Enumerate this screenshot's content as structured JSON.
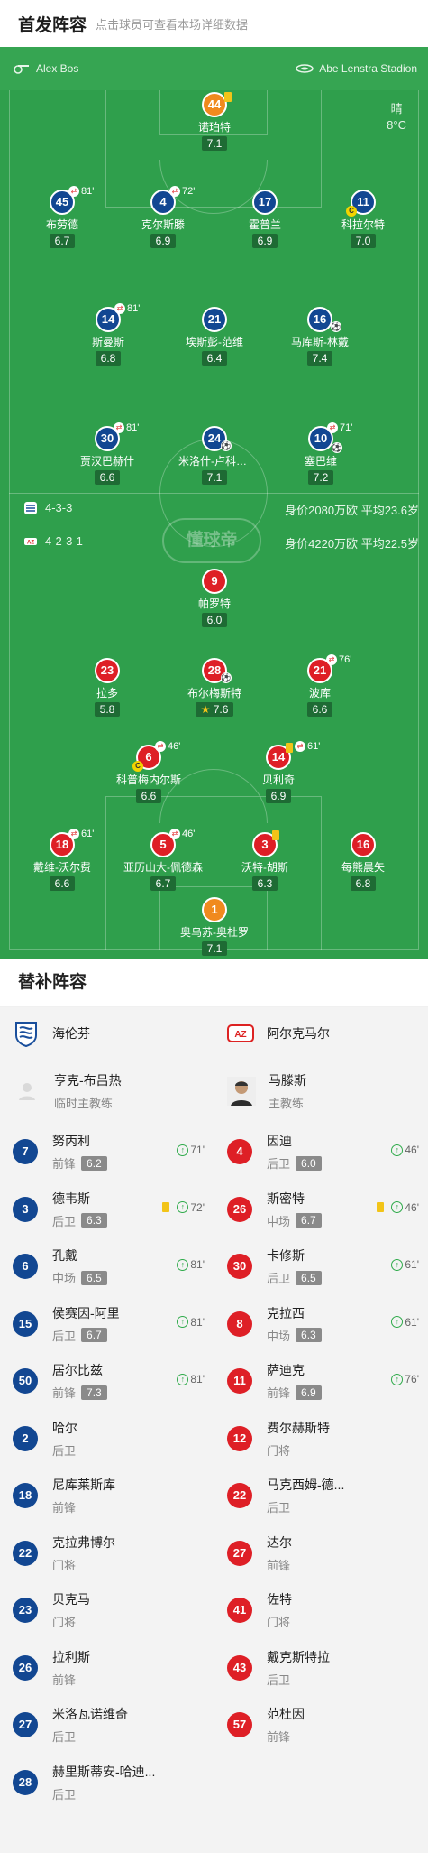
{
  "header": {
    "title": "首发阵容",
    "subtitle": "点击球员可查看本场详细数据"
  },
  "stadium": {
    "home_label": "Alex Bos",
    "away_label": "Abe Lenstra Stadion"
  },
  "weather": {
    "condition": "晴",
    "temp": "8°C"
  },
  "home_lineup": [
    {
      "num": "44",
      "name": "诺珀特",
      "rating": "7.1",
      "gk": true,
      "yellow": true
    },
    {
      "num": "45",
      "name": "布劳德",
      "rating": "6.7",
      "sub": "81'"
    },
    {
      "num": "4",
      "name": "克尔斯滕",
      "rating": "6.9",
      "sub": "72'"
    },
    {
      "num": "17",
      "name": "霍普兰",
      "rating": "6.9"
    },
    {
      "num": "11",
      "name": "科拉尔特",
      "rating": "7.0",
      "captain": true
    },
    {
      "num": "14",
      "name": "斯曼斯",
      "rating": "6.8",
      "sub": "81'"
    },
    {
      "num": "21",
      "name": "埃斯彭-范维",
      "rating": "6.4"
    },
    {
      "num": "16",
      "name": "马库斯-林戴",
      "rating": "7.4",
      "goal": true
    },
    {
      "num": "30",
      "name": "贾汉巴赫什",
      "rating": "6.6",
      "sub": "81'"
    },
    {
      "num": "24",
      "name": "米洛什-卢科维奇",
      "rating": "7.1",
      "goal": true
    },
    {
      "num": "10",
      "name": "塞巴维",
      "rating": "7.2",
      "sub": "71'",
      "goal": true
    }
  ],
  "formation_home": {
    "shape": "4-3-3",
    "value": "身价2080万欧",
    "age": "平均23.6岁"
  },
  "formation_away": {
    "shape": "4-2-3-1",
    "value": "身价4220万欧",
    "age": "平均22.5岁"
  },
  "watermark": "懂球帝",
  "away_lineup": [
    {
      "num": "9",
      "name": "帕罗特",
      "rating": "6.0"
    },
    {
      "num": "23",
      "name": "拉多",
      "rating": "5.8"
    },
    {
      "num": "28",
      "name": "布尔梅斯特",
      "rating": "7.6",
      "goal": true,
      "best": true
    },
    {
      "num": "21",
      "name": "波库",
      "rating": "6.6",
      "sub": "76'"
    },
    {
      "num": "6",
      "name": "科普梅内尔斯",
      "rating": "6.6",
      "sub": "46'",
      "captain": true
    },
    {
      "num": "14",
      "name": "贝利奇",
      "rating": "6.9",
      "sub": "61'",
      "yellow": true
    },
    {
      "num": "18",
      "name": "戴维-沃尔费",
      "rating": "6.6",
      "sub": "61'"
    },
    {
      "num": "5",
      "name": "亚历山大-佩德森",
      "rating": "6.7",
      "sub": "46'"
    },
    {
      "num": "3",
      "name": "沃特-胡斯",
      "rating": "6.3",
      "yellow": true
    },
    {
      "num": "16",
      "name": "每熊晨矢",
      "rating": "6.8"
    },
    {
      "num": "1",
      "name": "奥乌苏-奥杜罗",
      "rating": "7.1",
      "gk": true
    }
  ],
  "subs": {
    "title": "替补阵容",
    "home": {
      "team": "海伦芬",
      "coach": {
        "name": "亨克-布吕热",
        "role": "临时主教练"
      },
      "players": [
        {
          "num": "7",
          "name": "努丙利",
          "pos": "前锋",
          "rating": "6.2",
          "in": "71'"
        },
        {
          "num": "3",
          "name": "德韦斯",
          "pos": "后卫",
          "rating": "6.3",
          "in": "72'",
          "yellow": true
        },
        {
          "num": "6",
          "name": "孔戴",
          "pos": "中场",
          "rating": "6.5",
          "in": "81'"
        },
        {
          "num": "15",
          "name": "侯赛因-阿里",
          "pos": "后卫",
          "rating": "6.7",
          "in": "81'"
        },
        {
          "num": "50",
          "name": "居尔比兹",
          "pos": "前锋",
          "rating": "7.3",
          "in": "81'"
        },
        {
          "num": "2",
          "name": "哈尔",
          "pos": "后卫"
        },
        {
          "num": "18",
          "name": "尼库莱斯库",
          "pos": "前锋"
        },
        {
          "num": "22",
          "name": "克拉弗博尔",
          "pos": "门将"
        },
        {
          "num": "23",
          "name": "贝克马",
          "pos": "门将"
        },
        {
          "num": "26",
          "name": "拉利斯",
          "pos": "前锋"
        },
        {
          "num": "27",
          "name": "米洛瓦诺维奇",
          "pos": "后卫"
        },
        {
          "num": "28",
          "name": "赫里斯蒂安-哈迪...",
          "pos": "后卫"
        }
      ]
    },
    "away": {
      "team": "阿尔克马尔",
      "coach": {
        "name": "马滕斯",
        "role": "主教练"
      },
      "players": [
        {
          "num": "4",
          "name": "因迪",
          "pos": "后卫",
          "rating": "6.0",
          "in": "46'"
        },
        {
          "num": "26",
          "name": "斯密特",
          "pos": "中场",
          "rating": "6.7",
          "in": "46'",
          "yellow": true
        },
        {
          "num": "30",
          "name": "卡修斯",
          "pos": "后卫",
          "rating": "6.5",
          "in": "61'"
        },
        {
          "num": "8",
          "name": "克拉西",
          "pos": "中场",
          "rating": "6.3",
          "in": "61'"
        },
        {
          "num": "11",
          "name": "萨迪克",
          "pos": "前锋",
          "rating": "6.9",
          "in": "76'"
        },
        {
          "num": "12",
          "name": "费尔赫斯特",
          "pos": "门将"
        },
        {
          "num": "22",
          "name": "马克西姆-德...",
          "pos": "后卫"
        },
        {
          "num": "27",
          "name": "达尔",
          "pos": "前锋"
        },
        {
          "num": "41",
          "name": "佐特",
          "pos": "门将"
        },
        {
          "num": "43",
          "name": "戴克斯特拉",
          "pos": "后卫"
        },
        {
          "num": "57",
          "name": "范杜因",
          "pos": "前锋"
        }
      ]
    }
  }
}
